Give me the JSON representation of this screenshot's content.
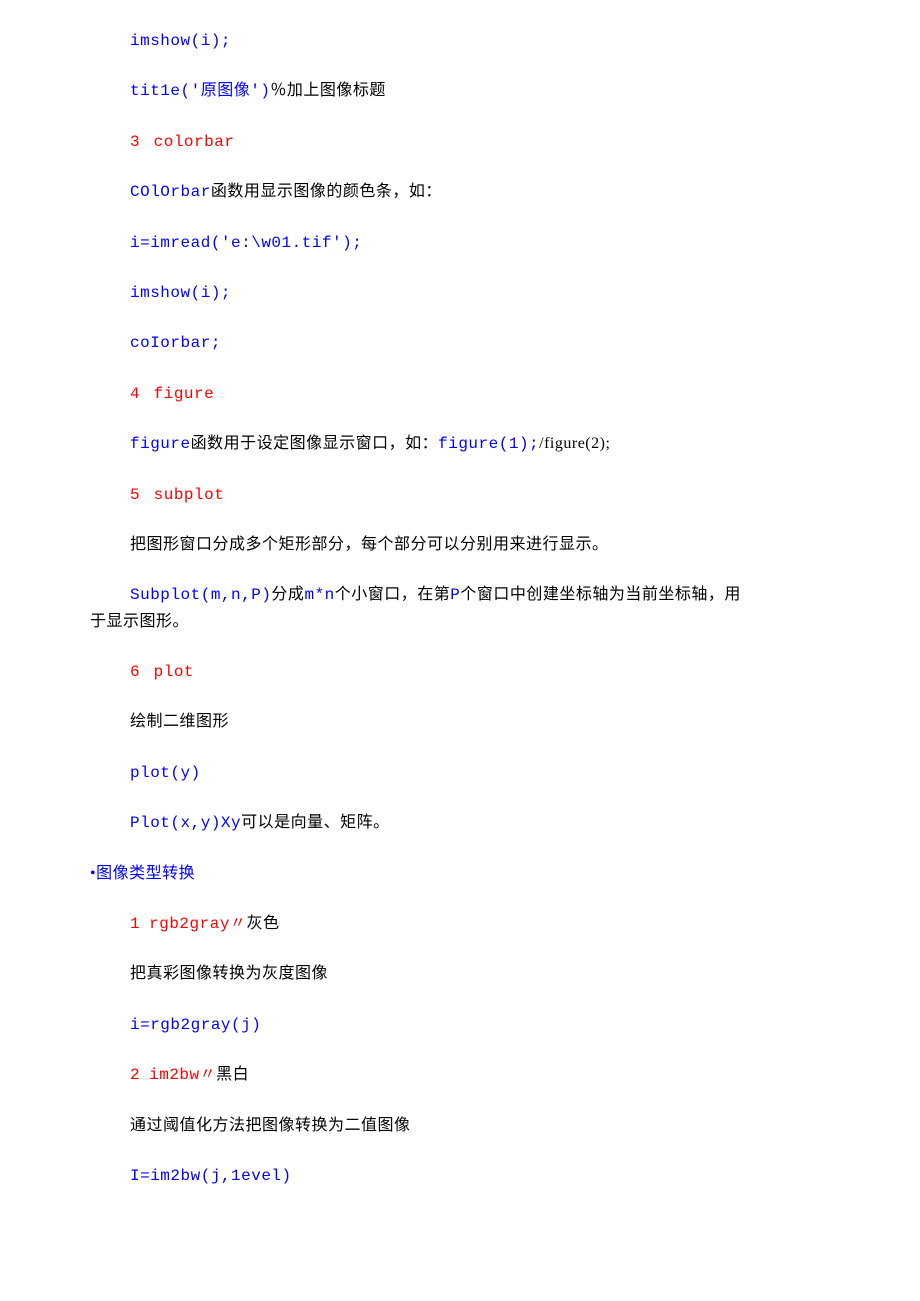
{
  "lines": {
    "l1": "imshow(i);",
    "l2a": "tit1e('原图像')",
    "l2b": "％加上图像标题",
    "l3a": "3",
    "l3b": "colorbar",
    "l4a": "COlOrbar",
    "l4b": "函数用显示图像的颜色条，如：",
    "l5": "i=imread('e:\\w01.tif');",
    "l6": "imshow(i);",
    "l7": "coIorbar;",
    "l8a": "4",
    "l8b": "figure",
    "l9a": "figure",
    "l9b": "函数用于设定图像显示窗口，如：",
    "l9c": "figure(1);",
    "l9d": "/figure(2);",
    "l10a": "5",
    "l10b": "subplot",
    "l11": "把图形窗口分成多个矩形部分，每个部分可以分别用来进行显示。",
    "l12a": "Subplot(m,n,P)",
    "l12b": "分成",
    "l12c": "m*n",
    "l12d": "个小窗口，在第",
    "l12e": "P",
    "l12f": "个窗口中创建坐标轴为当前坐标轴，用",
    "l12g": "于显示图形。",
    "l13a": "6",
    "l13b": "plot",
    "l14": "绘制二维图形",
    "l15": "plot(y)",
    "l16a": "Plot(x,y)Xy",
    "l16b": "可以是向量、矩阵。",
    "l17": "•图像类型转换",
    "l18a": "1",
    "l18b": "rgb2gray〃",
    "l18c": "灰色",
    "l19": "把真彩图像转换为灰度图像",
    "l20": "i=rgb2gray(j)",
    "l21a": "2",
    "l21b": "im2bw〃",
    "l21c": "黑白",
    "l22": "通过阈值化方法把图像转换为二值图像",
    "l23": "I=im2bw(j,1evel)"
  }
}
